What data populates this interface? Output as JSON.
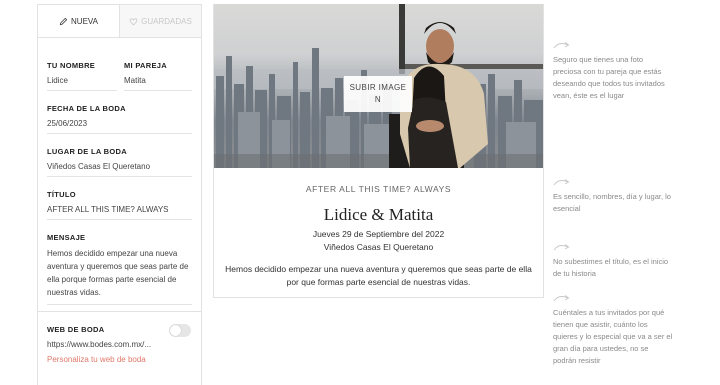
{
  "tabs": {
    "new": {
      "label": "NUEVA",
      "icon": "pencil-icon"
    },
    "saved": {
      "label": "GUARDADAS",
      "icon": "heart-icon"
    }
  },
  "form": {
    "your_name": {
      "label": "TU NOMBRE",
      "value": "Lidice"
    },
    "partner": {
      "label": "MI PAREJA",
      "value": "Matita"
    },
    "date": {
      "label": "FECHA DE LA BODA",
      "value": "25/06/2023"
    },
    "venue": {
      "label": "LUGAR DE LA BODA",
      "value": "Viñedos Casas El Queretano"
    },
    "title": {
      "label": "TÍTULO",
      "value": "AFTER ALL THIS TIME? ALWAYS"
    },
    "message": {
      "label": "MENSAJE",
      "value": "Hemos decidido empezar una nueva aventura y queremos que seas parte de ella porque formas parte esencial de nuestras vidas."
    },
    "website": {
      "label": "WEB DE BODA",
      "url": "https://www.bodes.com.mx/...",
      "toggle_on": false,
      "customize_link": "Personaliza tu web de boda"
    }
  },
  "preview": {
    "upload_button": "SUBIR IMAGEN",
    "tagline": "AFTER ALL THIS TIME? ALWAYS",
    "names": "Lidice & Matita",
    "date": "Jueves 29 de Septiembre del 2022",
    "venue": "Viñedos Casas El Queretano",
    "message": "Hemos decidido empezar una nueva aventura y queremos que seas parte de ella por que formas parte esencial de nuestras vidas."
  },
  "hints": [
    "Seguro que tienes una foto preciosa con tu pareja que estás deseando que todos tus invitados vean, éste es el lugar",
    "Es sencillo, nombres, día y lugar, lo esencial",
    "No subestimes el título, es el inicio de tu historia",
    "Cuéntales a tus invitados por qué tienen que asistir, cuánto los quieres y lo especial que va a ser el gran día para ustedes, no se podrán resistir"
  ],
  "colors": {
    "accent_link": "#e07a6a",
    "border": "#e2e2e2",
    "hint_text": "#8a8a8a",
    "arrow": "#c8c8c8"
  }
}
